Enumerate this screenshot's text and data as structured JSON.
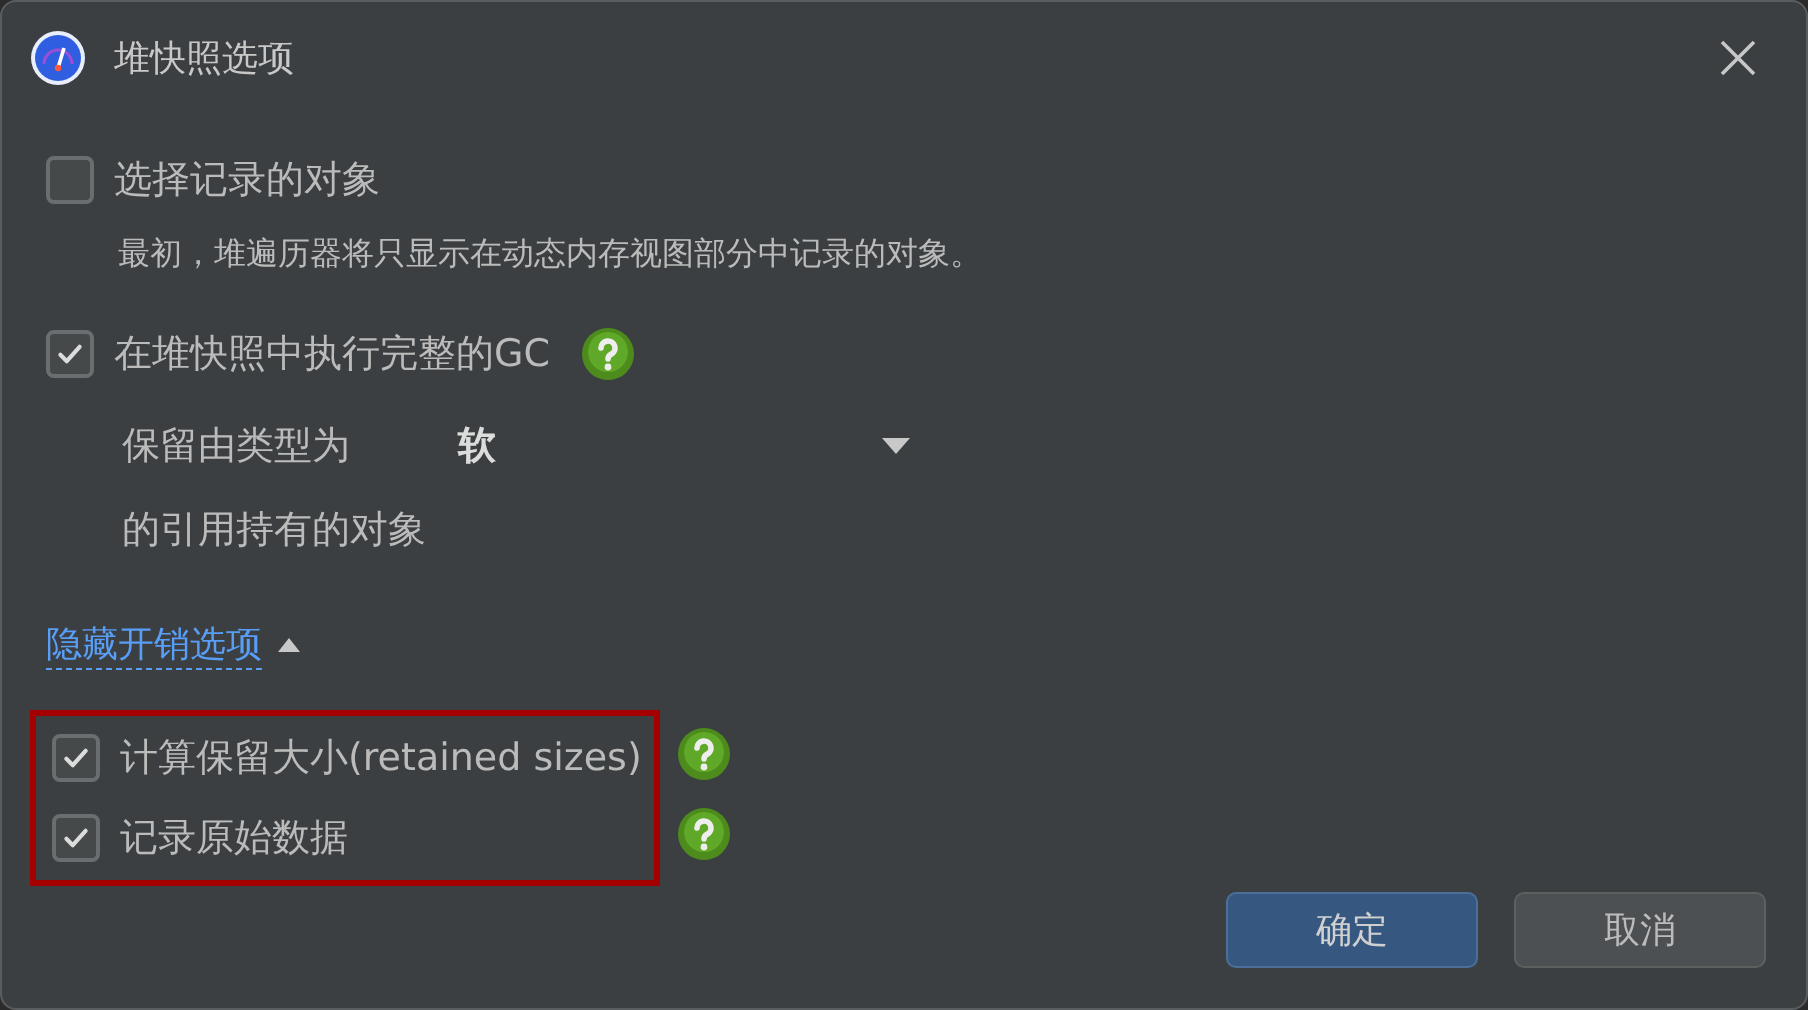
{
  "window": {
    "title": "堆快照选项"
  },
  "select_recorded": {
    "label": "选择记录的对象",
    "checked": false,
    "description": "最初，堆遍历器将只显示在动态内存视图部分中记录的对象。"
  },
  "full_gc": {
    "label": "在堆快照中执行完整的GC",
    "checked": true
  },
  "retain": {
    "label": "保留由类型为",
    "value": "软",
    "suffix": "的引用持有的对象"
  },
  "overhead_toggle": {
    "label": "隐藏开销选项",
    "expanded": true
  },
  "overhead_group": {
    "highlighted": true,
    "options": [
      {
        "label": "计算保留大小(retained sizes)",
        "checked": true
      },
      {
        "label": "记录原始数据",
        "checked": true
      }
    ]
  },
  "buttons": [
    {
      "label": "确定",
      "kind": "primary"
    },
    {
      "label": "取消",
      "kind": "secondary"
    }
  ]
}
